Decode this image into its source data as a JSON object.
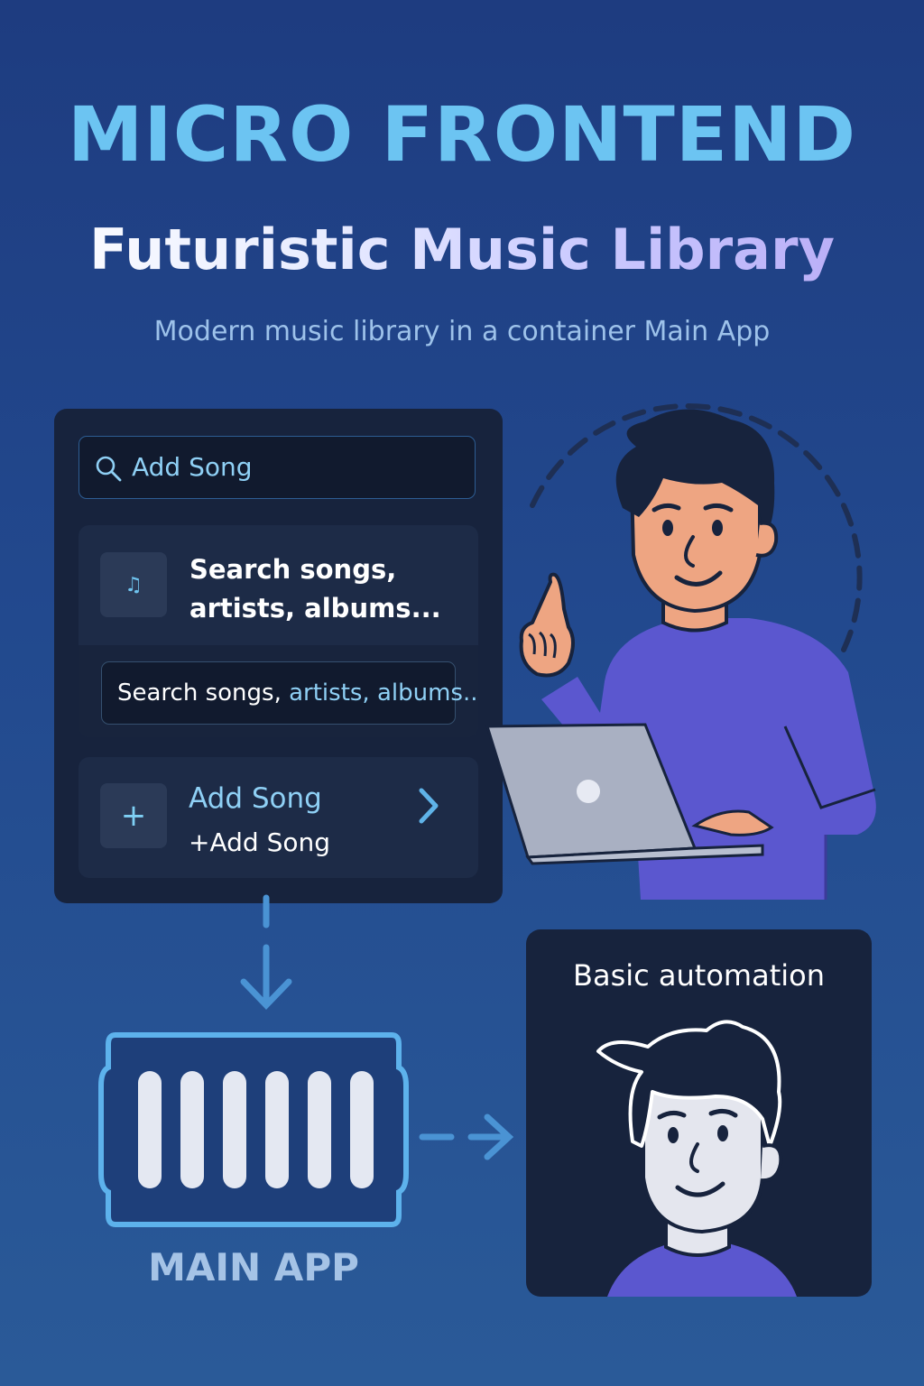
{
  "header": {
    "title": "MICRO FRONTEND",
    "subtitle": "Futuristic Music Library",
    "tagline": "Modern music library in a container Main App"
  },
  "panel": {
    "search_bar_label": "Add Song",
    "card1_text": "Search songs, artists, albums...",
    "inner_search_prefix": "Search songs, ",
    "inner_search_highlight": "artists, albums..",
    "card2_title": "Add Song",
    "card2_subtitle": "+Add Song"
  },
  "main_app_label": "MAIN APP",
  "automation_label": "Basic automation",
  "icons": {
    "search": "search-icon",
    "note": "music-note-icon",
    "plus": "plus-icon",
    "chevron": "chevron-right-icon"
  },
  "colors": {
    "title": "#6cc4f2",
    "accent": "#8fd0f5",
    "panel": "#17233d",
    "sweater": "#5b57cf"
  }
}
